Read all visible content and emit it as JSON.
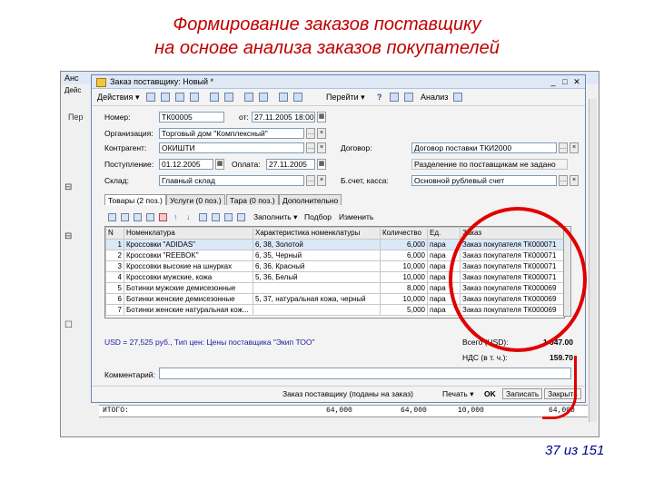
{
  "slide": {
    "title_line1": "Формирование заказов поставщику",
    "title_line2": "на основе анализа заказов покупателей",
    "counter": "37 из 151"
  },
  "background_window": {
    "title": "Анс",
    "menu": "Дейс",
    "left_label": "Пер",
    "bottom_row": {
      "label": "ИТОГО:",
      "v1": "64,000",
      "v2": "64,000",
      "v3": "10,000",
      "v4": "64,000"
    }
  },
  "order_window": {
    "title": "Заказ поставщику: Новый *",
    "toolbar": {
      "actions": "Действия",
      "go_to": "Перейти",
      "analysis": "Анализ"
    },
    "fields": {
      "number_label": "Номер:",
      "number": "ТК00005",
      "from_label": "от:",
      "date": "27.11.2005 18:00:00",
      "organization_label": "Организация:",
      "organization": "Торговый дом \"Комплексный\"",
      "counterparty_label": "Контрагент:",
      "counterparty": "ОКИШТИ",
      "contract_label": "Договор:",
      "contract": "Договор поставки ТКИ2000",
      "receipt_label": "Поступление:",
      "receipt_date": "01.12.2005",
      "payment_label": "Оплата:",
      "payment_date": "27.11.2005",
      "split_note": "Разделение по поставщикам не задано",
      "warehouse_label": "Склад:",
      "warehouse": "Главный склад",
      "account_label": "Б.счет, касса:",
      "account": "Основной рублевый счет"
    },
    "tabs": [
      "Товары (2 поз.)",
      "Услуги (0 поз.)",
      "Тара (0 поз.)",
      "Дополнительно"
    ],
    "grid_toolbar": {
      "fill": "Заполнить",
      "select": "Подбор",
      "change": "Изменить"
    },
    "table": {
      "headers": [
        "N",
        "Номенклатура",
        "Характеристика номенклатуры",
        "Количество",
        "Ед.",
        "Заказ"
      ],
      "rows": [
        [
          "1",
          "Кроссовки \"ADIDAS\"",
          "6, 38, Золотой",
          "6,000",
          "пара",
          "Заказ покупателя ТК000071"
        ],
        [
          "2",
          "Кроссовки \"REEBOK\"",
          "6, 35, Черный",
          "6,000",
          "пара",
          "Заказ покупателя ТК000071"
        ],
        [
          "3",
          "Кроссовки высокие на шнурках",
          "6, 36, Красный",
          "10,000",
          "пара",
          "Заказ покупателя ТК000071"
        ],
        [
          "4",
          "Кроссовки мужские, кожа",
          "5, 36, Белый",
          "10,000",
          "пара",
          "Заказ покупателя ТК000071"
        ],
        [
          "5",
          "Ботинки мужские демисезонные",
          "",
          "8,000",
          "пара",
          "Заказ покупателя ТК000069"
        ],
        [
          "6",
          "Ботинки женские демисезонные",
          "5, 37, натуральная кожа, черный",
          "10,000",
          "пара",
          "Заказ покупателя ТК000069"
        ],
        [
          "7",
          "Ботинки женские натуральная кож...",
          "",
          "5,000",
          "пара",
          "Заказ покупателя ТК000069"
        ]
      ]
    },
    "price_note": "USD = 27,525 руб., Тип цен: Цены поставщика \"Экип ТОО\"",
    "totals": {
      "total_label": "Всего (USD):",
      "total": "1 047.00",
      "vat_label": "НДС (в т. ч.):",
      "vat": "159.70"
    },
    "comment_label": "Комментарий:",
    "bottom": {
      "doc_name": "Заказ поставщику (поданы на заказ)",
      "print": "Печать",
      "ok": "OK",
      "save": "Записать",
      "close": "Закрыть"
    }
  },
  "accent_colors": {
    "title": "#c00000",
    "highlight": "#e00000",
    "counter": "#00008b"
  }
}
